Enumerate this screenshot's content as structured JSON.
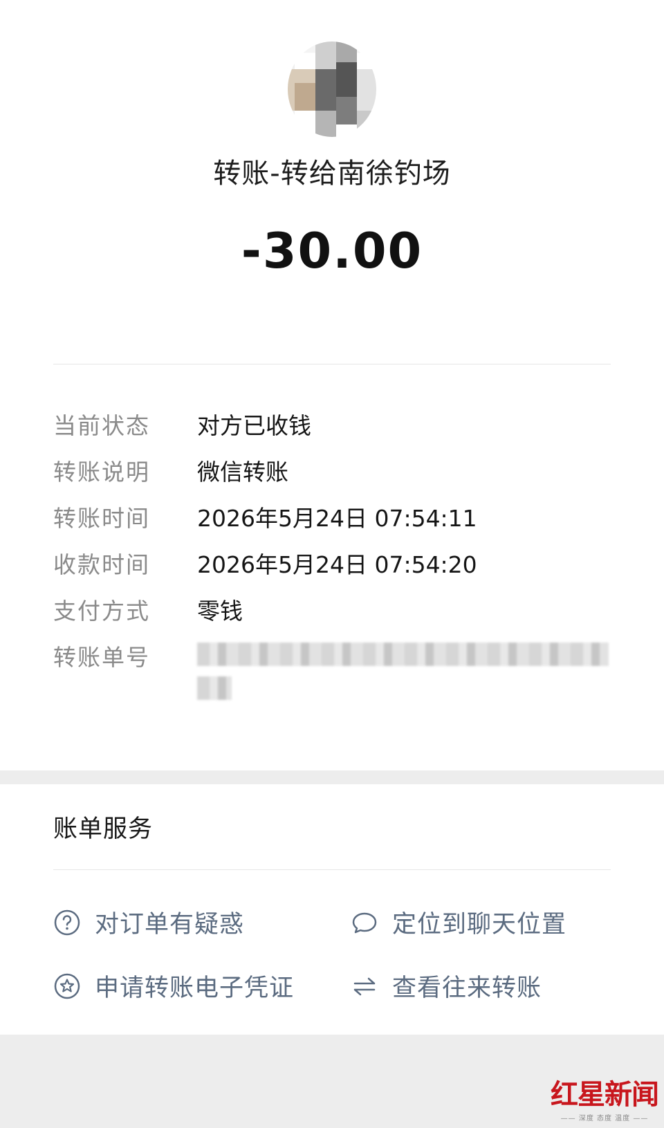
{
  "transfer": {
    "title": "转账-转给南徐钓场",
    "amount": "-30.00"
  },
  "details": [
    {
      "label": "当前状态",
      "value": "对方已收钱"
    },
    {
      "label": "转账说明",
      "value": "微信转账"
    },
    {
      "label": "转账时间",
      "value": "2026年5月24日 07:54:11"
    },
    {
      "label": "收款时间",
      "value": "2026年5月24日 07:54:20"
    },
    {
      "label": "支付方式",
      "value": "零钱"
    },
    {
      "label": "转账单号",
      "value": ""
    }
  ],
  "bill_service": {
    "title": "账单服务",
    "actions": [
      {
        "label": "对订单有疑惑",
        "icon": "question-circle-icon"
      },
      {
        "label": "定位到聊天位置",
        "icon": "chat-bubble-icon"
      },
      {
        "label": "申请转账电子凭证",
        "icon": "star-badge-icon"
      },
      {
        "label": "查看往来转账",
        "icon": "swap-arrows-icon"
      }
    ]
  },
  "watermark": {
    "name": "红星新闻",
    "tagline": "—— 深度 态度 温度 ——"
  },
  "colors": {
    "page_bg": "#ededed",
    "card_bg": "#ffffff",
    "label_gray": "#8a8a8a",
    "link_blue_gray": "#5b6b80",
    "watermark_red": "#c8161d"
  }
}
